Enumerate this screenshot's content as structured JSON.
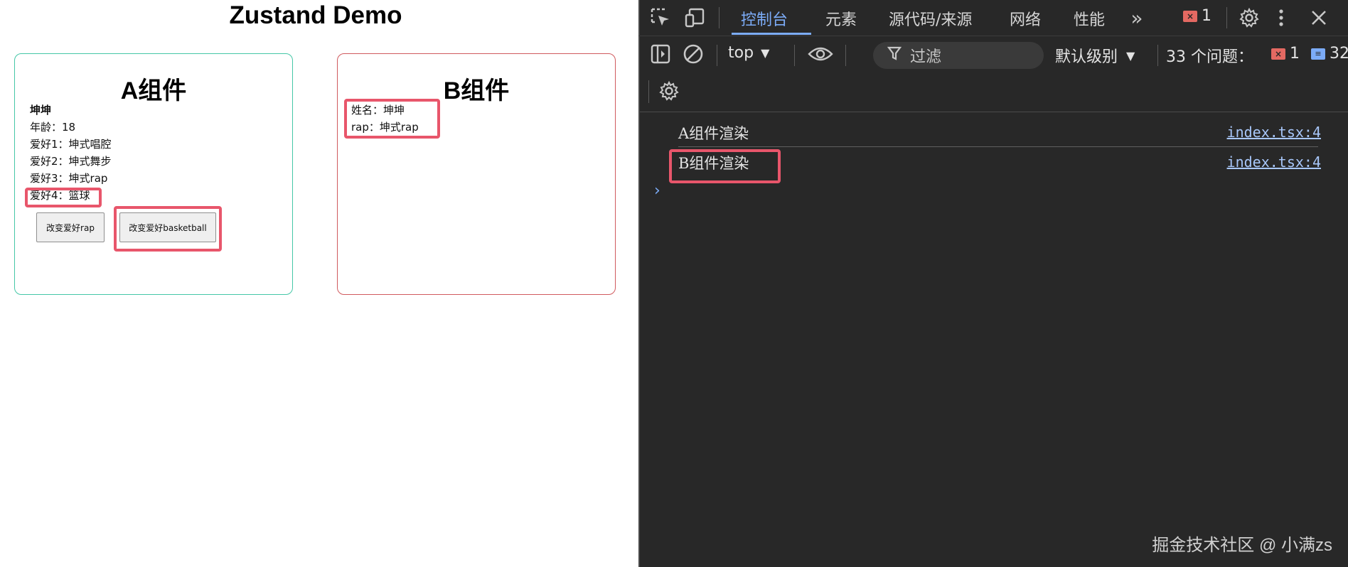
{
  "app": {
    "title": "Zustand Demo",
    "component_a": {
      "heading": "A组件",
      "name": "坤坤",
      "age": "年龄：18",
      "hobby1": "爱好1：坤式唱腔",
      "hobby2": "爱好2：坤式舞步",
      "hobby3": "爱好3：坤式rap",
      "hobby4": "爱好4：篮球",
      "btn_rap": "改变爱好rap",
      "btn_basketball": "改变爱好basketball"
    },
    "component_b": {
      "heading": "B组件",
      "name_line": "姓名：坤坤",
      "rap_line": "rap：坤式rap"
    }
  },
  "devtools": {
    "tabs": [
      "控制台",
      "元素",
      "源代码/来源",
      "网络",
      "性能"
    ],
    "error_count": "1",
    "context": "top",
    "filter_placeholder": "过滤",
    "level": "默认级别",
    "issues_label": "33 个问题：",
    "issues_error_count": "1",
    "issues_msg_count": "32",
    "console_rows": [
      {
        "message": "A组件渲染",
        "source": "index.tsx:4"
      },
      {
        "message": "B组件渲染",
        "source": "index.tsx:4"
      }
    ],
    "prompt": "›",
    "watermark": "掘金技术社区 @ 小满zs"
  },
  "colors": {
    "accent_red": "#e8566b",
    "card_a_border": "#45c7a7",
    "card_b_border": "#d05a5e",
    "devtools_bg": "#282828",
    "tab_active": "#7cacf8"
  },
  "icons": [
    "inspect-icon",
    "device-toggle-icon",
    "more-tabs-icon",
    "settings-gear-icon",
    "more-vert-icon",
    "close-icon",
    "sidebar-toggle-icon",
    "clear-console-icon",
    "dropdown-arrow-icon",
    "eye-icon",
    "filter-funnel-icon",
    "console-settings-icon",
    "console-prompt-icon"
  ]
}
